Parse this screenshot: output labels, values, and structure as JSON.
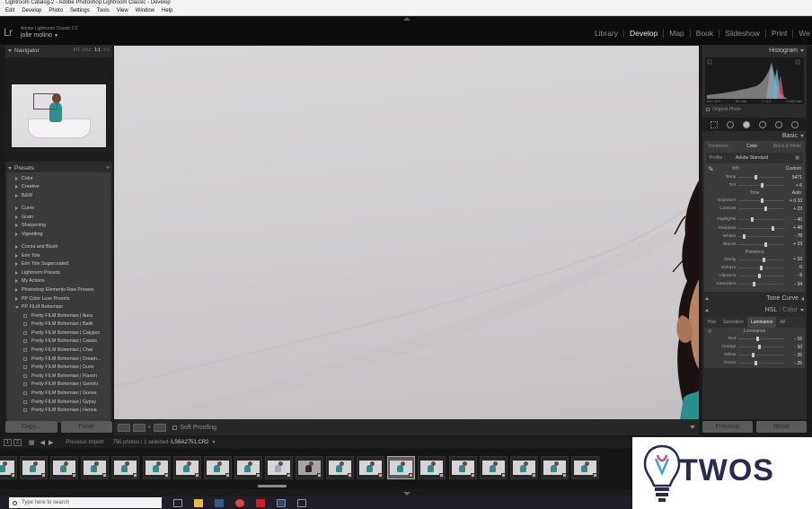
{
  "window": {
    "title": "Lightroom Catalog-2 - Adobe Photoshop Lightroom Classic - Develop"
  },
  "menu": [
    "Edit",
    "Develop",
    "Photo",
    "Settings",
    "Tools",
    "View",
    "Window",
    "Help"
  ],
  "identity": {
    "logo": "Lr",
    "brand": "Adobe Lightroom Classic CC",
    "user": "jolie molino",
    "user_caret": "▼"
  },
  "modules": [
    "Library",
    "Develop",
    "Map",
    "Book",
    "Slideshow",
    "Print",
    "We"
  ],
  "active_module": "Develop",
  "navigator": {
    "title": "Navigator",
    "zoom_options": [
      "FIT",
      "FILL",
      "1:1",
      "3:1"
    ],
    "zoom_active": "1:1"
  },
  "presets": {
    "title": "Presets",
    "add": "+",
    "group1": [
      "Color",
      "Creative",
      "B&W"
    ],
    "group2": [
      "Curve",
      "Grain",
      "Sharpening",
      "Vignetting"
    ],
    "group3": [
      "Cocoa and Blush",
      "Erin Tole",
      "Erin Tole Sugarcoated",
      "Lightroom Presets",
      "My Actions",
      "Photoshop Elements Raw Presets",
      "PP Color Luxe Presets"
    ],
    "open_group": "PP FILM Bohemian",
    "items": [
      "Pretty FILM Bohemian | Aura",
      "Pretty FILM Bohemian | Batik",
      "Pretty FILM Bohemian | Calypso",
      "Pretty FILM Bohemian | Cassis",
      "Pretty FILM Bohemian | Chai",
      "Pretty FILM Bohemian | Dream...",
      "Pretty FILM Bohemian | Dune",
      "Pretty FILM Bohemian | Flaxen",
      "Pretty FILM Bohemian | Gemini",
      "Pretty FILM Bohemian | Goose",
      "Pretty FILM Bohemian | Gypsy",
      "Pretty FILM Bohemian | Henna"
    ]
  },
  "left_buttons": {
    "copy": "Copy...",
    "paste": "Paste"
  },
  "toolbar": {
    "soft_proofing": "Soft Proofing"
  },
  "histogram": {
    "title": "Histogram",
    "iso": "ISO 400",
    "focal": "50 mm",
    "aperture": "f / 2.2",
    "shutter": "1/160 sec",
    "original_photo": "Original Photo"
  },
  "basic": {
    "title": "Basic",
    "treatment_label": "Treatment :",
    "treatment_color": "Color",
    "treatment_bw": "Black & White",
    "profile_label": "Profile :",
    "profile_value": "Adobe Standard",
    "wb_label": "WB :",
    "wb_value": "Custom",
    "tone_label": "Tone",
    "auto_label": "Auto",
    "presence_label": "Presence",
    "temp_tint": [
      {
        "label": "Temp",
        "value": "5471",
        "pos": 0.38
      },
      {
        "label": "Tint",
        "value": "+ 6",
        "pos": 0.52
      }
    ],
    "tone": [
      {
        "label": "Exposure",
        "value": "+ 0.10",
        "pos": 0.52
      },
      {
        "label": "Contrast",
        "value": "+ 23",
        "pos": 0.6
      }
    ],
    "tone2": [
      {
        "label": "Highlights",
        "value": "- 40",
        "pos": 0.3
      },
      {
        "label": "Shadows",
        "value": "+ 48",
        "pos": 0.74
      },
      {
        "label": "Whites",
        "value": "- 78",
        "pos": 0.12
      },
      {
        "label": "Blacks",
        "value": "+ 19",
        "pos": 0.6
      }
    ],
    "presence": [
      {
        "label": "Clarity",
        "value": "+ 10",
        "pos": 0.55
      },
      {
        "label": "Dehaze",
        "value": "0",
        "pos": 0.5
      },
      {
        "label": "Vibrance",
        "value": "- 8",
        "pos": 0.46
      },
      {
        "label": "Saturation",
        "value": "- 34",
        "pos": 0.33
      }
    ]
  },
  "tone_curve": {
    "title": "Tone Curve"
  },
  "hsl": {
    "title_hsl": "HSL",
    "divider": "/",
    "title_color": "Color",
    "tabs": [
      "Hue",
      "Saturation",
      "Luminance",
      "All"
    ],
    "active_tab": "Luminance",
    "section": "Luminance",
    "sliders": [
      {
        "label": "Red",
        "value": "- 15",
        "pos": 0.42
      },
      {
        "label": "Orange",
        "value": "- 10",
        "pos": 0.45
      },
      {
        "label": "Yellow",
        "value": "- 35",
        "pos": 0.32
      },
      {
        "label": "Green",
        "value": "- 25",
        "pos": 0.37
      }
    ]
  },
  "right_buttons": {
    "previous": "Previous",
    "reset": "Reset"
  },
  "filmstrip": {
    "source": "Previous Import",
    "count": "756 photos / 1 selected /",
    "filename": "LS6A2751.CR2",
    "caret": "▼",
    "screen1": "1",
    "screen2": "2",
    "frames": 20,
    "selected_index": 13
  },
  "taskbar": {
    "search_placeholder": "Type here to search"
  },
  "watermark": {
    "text": "TWOS"
  }
}
